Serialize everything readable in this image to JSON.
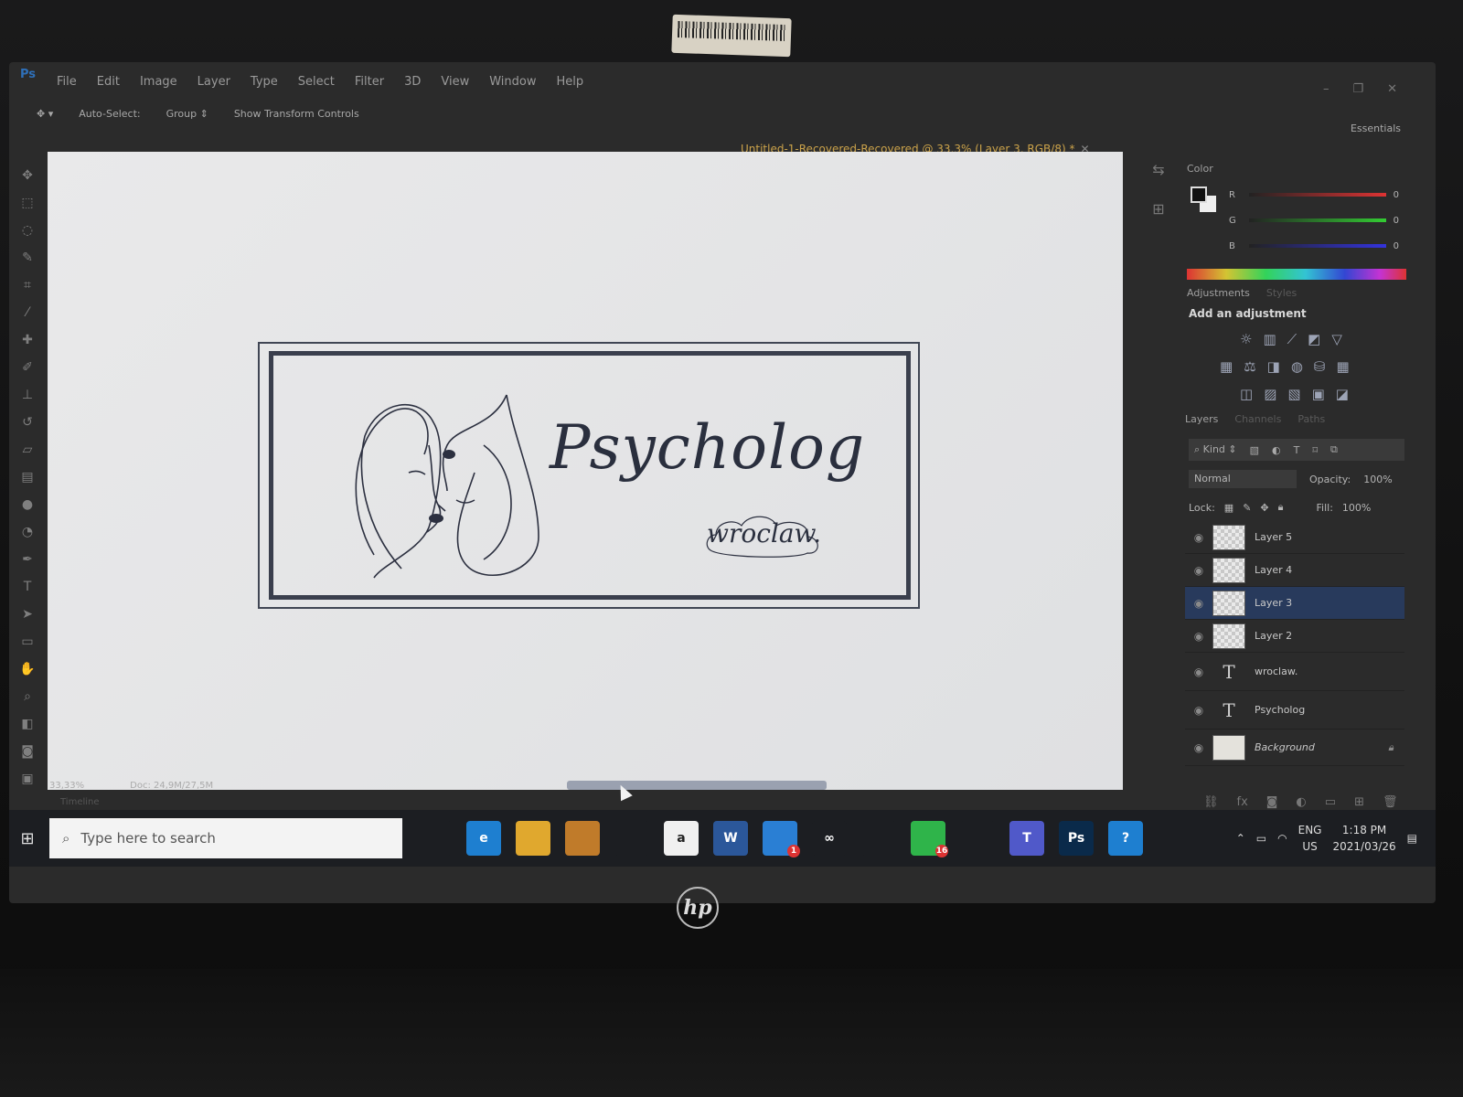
{
  "photoshop": {
    "menu": [
      "File",
      "Edit",
      "Image",
      "Layer",
      "Type",
      "Select",
      "Filter",
      "3D",
      "View",
      "Window",
      "Help"
    ],
    "options": {
      "auto_select": "Auto-Select:",
      "group": "Group",
      "show_transform": "Show Transform Controls"
    },
    "workspace": "Essentials",
    "doc_tab": "Untitled-1-Recovered-Recovered @ 33,3% (Layer 3, RGB/8) *",
    "canvas": {
      "title": "Psycholog",
      "subtitle": "wroclaw."
    },
    "status": {
      "zoom": "33,33%",
      "doc": "Doc: 24,9M/27,5M"
    },
    "timeline": "Timeline",
    "color_panel": {
      "title": "Color",
      "r_label": "R",
      "g_label": "G",
      "b_label": "B",
      "r": "0",
      "g": "0",
      "b": "0"
    },
    "adjustments": {
      "tab": "Adjustments",
      "tab2": "Styles",
      "hint": "Add an adjustment"
    },
    "layers_panel": {
      "tabs": [
        "Layers",
        "Channels",
        "Paths"
      ],
      "kind": "Kind",
      "blend_mode": "Normal",
      "opacity_label": "Opacity:",
      "opacity": "100%",
      "lock_label": "Lock:",
      "fill_label": "Fill:",
      "fill": "100%",
      "layers": [
        {
          "name": "Layer 5",
          "type": "pixel",
          "selected": false
        },
        {
          "name": "Layer 4",
          "type": "pixel",
          "selected": false
        },
        {
          "name": "Layer 3",
          "type": "pixel",
          "selected": true
        },
        {
          "name": "Layer 2",
          "type": "pixel",
          "selected": false
        },
        {
          "name": "wroclaw.",
          "type": "text",
          "selected": false
        },
        {
          "name": "Psycholog",
          "type": "text",
          "selected": false
        },
        {
          "name": "Background",
          "type": "background",
          "selected": false
        }
      ]
    }
  },
  "taskbar": {
    "search_placeholder": "Type here to search",
    "apps": [
      {
        "icon": "task-view-icon",
        "label": "",
        "color": "#1c1e22"
      },
      {
        "icon": "edge-icon",
        "label": "e",
        "color": "#1e7fd0"
      },
      {
        "icon": "file-explorer-icon",
        "label": "",
        "color": "#e0a82e"
      },
      {
        "icon": "store-icon",
        "label": "",
        "color": "#c07b2a"
      },
      {
        "icon": "dropbox-icon",
        "label": "",
        "color": "#1c1e22"
      },
      {
        "icon": "amazon-icon",
        "label": "a",
        "color": "#f0f0f0"
      },
      {
        "icon": "word-icon",
        "label": "W",
        "color": "#2b579a"
      },
      {
        "icon": "mail-icon",
        "label": "",
        "color": "#2a7fd4",
        "badge": "1"
      },
      {
        "icon": "infinity-icon",
        "label": "∞",
        "color": "#1c1e22"
      },
      {
        "icon": "chrome-icon",
        "label": "",
        "color": "#1c1e22"
      },
      {
        "icon": "whatsapp-icon",
        "label": "",
        "color": "#2fb44a",
        "badge": "16"
      },
      {
        "icon": "chrome-profile-icon",
        "label": "",
        "color": "#1c1e22"
      },
      {
        "icon": "teams-icon",
        "label": "T",
        "color": "#5059c9"
      },
      {
        "icon": "photoshop-icon",
        "label": "Ps",
        "color": "#0a2a4a"
      },
      {
        "icon": "help-icon",
        "label": "?",
        "color": "#1e7fd0"
      }
    ],
    "tray": {
      "lang": "ENG",
      "region": "US",
      "time": "1:18 PM",
      "date": "2021/03/26"
    }
  },
  "device": {
    "brand": "hp"
  }
}
